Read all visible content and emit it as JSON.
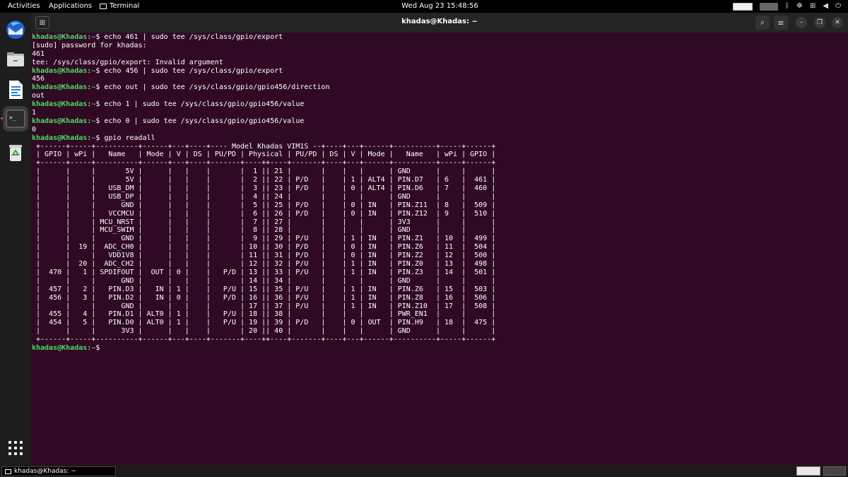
{
  "topbar": {
    "activities": "Activities",
    "applications": "Applications",
    "terminal": "Terminal",
    "datetime": "Wed Aug 23  15:48:56"
  },
  "dock": {
    "apps": [
      {
        "name": "Thunderbird Mail"
      },
      {
        "name": "Files"
      },
      {
        "name": "LibreOffice Writer"
      },
      {
        "name": "Terminal"
      },
      {
        "name": "Trash"
      }
    ]
  },
  "window": {
    "title": "khadas@Khadas: ~"
  },
  "terminal": {
    "prompt_user": "khadas@Khadas",
    "prompt_path": "~",
    "lines": [
      {
        "type": "cmd",
        "text": "echo 461 | sudo tee /sys/class/gpio/export"
      },
      {
        "type": "out",
        "text": "[sudo] password for khadas:"
      },
      {
        "type": "out",
        "text": "461"
      },
      {
        "type": "out",
        "text": "tee: /sys/class/gpio/export: Invalid argument"
      },
      {
        "type": "cmd",
        "text": "echo 456 | sudo tee /sys/class/gpio/export"
      },
      {
        "type": "out",
        "text": "456"
      },
      {
        "type": "cmd",
        "text": "echo out | sudo tee /sys/class/gpio/gpio456/direction"
      },
      {
        "type": "out",
        "text": "out"
      },
      {
        "type": "cmd",
        "text": "echo 1 | sudo tee /sys/class/gpio/gpio456/value"
      },
      {
        "type": "out",
        "text": "1"
      },
      {
        "type": "cmd",
        "text": "echo 0 | sudo tee /sys/class/gpio/gpio456/value"
      },
      {
        "type": "out",
        "text": "0"
      },
      {
        "type": "cmd",
        "text": "gpio readall"
      },
      {
        "type": "out",
        "text": " +------+-----+----------+------+---+----+---- Model Khadas VIM1S --+----+---+------+----------+-----+------+"
      },
      {
        "type": "out",
        "text": " | GPIO | wPi |   Name   | Mode | V | DS | PU/PD | Physical | PU/PD | DS | V | Mode |   Name   | wPi | GPIO |"
      },
      {
        "type": "out",
        "text": " +------+-----+----------+------+---+----+-------+----++----+-------+----+---+------+----------+-----+------+"
      },
      {
        "type": "out",
        "text": " |      |     |       5V |      |   |    |       |  1 || 21 |       |    |   |      | GND      |     |      |"
      },
      {
        "type": "out",
        "text": " |      |     |       5V |      |   |    |       |  2 || 22 | P/D   |    | 1 | ALT4 | PIN.D7   | 6   |  461 |"
      },
      {
        "type": "out",
        "text": " |      |     |   USB_DM |      |   |    |       |  3 || 23 | P/D   |    | 0 | ALT4 | PIN.D6   | 7   |  460 |"
      },
      {
        "type": "out",
        "text": " |      |     |   USB_DP |      |   |    |       |  4 || 24 |       |    |   |      | GND      |     |      |"
      },
      {
        "type": "out",
        "text": " |      |     |      GND |      |   |    |       |  5 || 25 | P/D   |    | 0 | IN   | PIN.Z11  | 8   |  509 |"
      },
      {
        "type": "out",
        "text": " |      |     |   VCCMCU |      |   |    |       |  6 || 26 | P/D   |    | 0 | IN   | PIN.Z12  | 9   |  510 |"
      },
      {
        "type": "out",
        "text": " |      |     | MCU_NRST |      |   |    |       |  7 || 27 |       |    |   |      | 3V3      |     |      |"
      },
      {
        "type": "out",
        "text": " |      |     | MCU_SWIM |      |   |    |       |  8 || 28 |       |    |   |      | GND      |     |      |"
      },
      {
        "type": "out",
        "text": " |      |     |      GND |      |   |    |       |  9 || 29 | P/U   |    | 1 | IN   | PIN.Z1   | 10  |  499 |"
      },
      {
        "type": "out",
        "text": " |      |  19 |  ADC_CH0 |      |   |    |       | 10 || 30 | P/D   |    | 0 | IN   | PIN.Z6   | 11  |  504 |"
      },
      {
        "type": "out",
        "text": " |      |     |   VDD1V8 |      |   |    |       | 11 || 31 | P/D   |    | 0 | IN   | PIN.Z2   | 12  |  500 |"
      },
      {
        "type": "out",
        "text": " |      |  20 |  ADC_CH2 |      |   |    |       | 12 || 32 | P/U   |    | 1 | IN   | PIN.Z0   | 13  |  498 |"
      },
      {
        "type": "out",
        "text": " |  470 |   1 | SPDIFOUT |  OUT | 0 |    |   P/D | 13 || 33 | P/U   |    | 1 | IN   | PIN.Z3   | 14  |  501 |"
      },
      {
        "type": "out",
        "text": " |      |     |      GND |      |   |    |       | 14 || 34 |       |    |   |      | GND      |     |      |"
      },
      {
        "type": "out",
        "text": " |  457 |   2 |   PIN.D3 |   IN | 1 |    |   P/U | 15 || 35 | P/U   |    | 1 | IN   | PIN.Z6   | 15  |  503 |"
      },
      {
        "type": "out",
        "text": " |  456 |   3 |   PIN.D2 |   IN | 0 |    |   P/D | 16 || 36 | P/U   |    | 1 | IN   | PIN.Z8   | 16  |  506 |"
      },
      {
        "type": "out",
        "text": " |      |     |      GND |      |   |    |       | 17 || 37 | P/U   |    | 1 | IN   | PIN.Z10  | 17  |  508 |"
      },
      {
        "type": "out",
        "text": " |  455 |   4 |   PIN.D1 | ALT0 | 1 |    |   P/U | 18 || 38 |       |    |   |      | PWR_EN1  |     |      |"
      },
      {
        "type": "out",
        "text": " |  454 |   5 |   PIN.D0 | ALT0 | 1 |    |   P/U | 19 || 39 | P/D   |    | 0 | OUT  | PIN.H9   | 18  |  475 |"
      },
      {
        "type": "out",
        "text": " |      |     |      3V3 |      |   |    |       | 20 || 40 |       |    |   |      | GND      |     |      |"
      },
      {
        "type": "out",
        "text": " +------+-----+----------+------+---+----+-------+----++----+-------+----+---+------+----------+-----+------+"
      },
      {
        "type": "cmd",
        "text": ""
      }
    ]
  },
  "taskbar": {
    "item_label": "khadas@Khadas: ~"
  }
}
